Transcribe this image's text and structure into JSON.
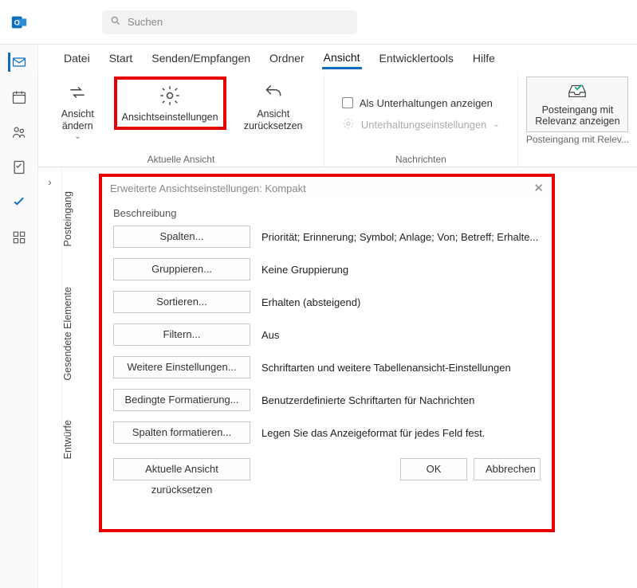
{
  "app": {
    "search_placeholder": "Suchen"
  },
  "menu": {
    "file": "Datei",
    "start": "Start",
    "sendrecv": "Senden/Empfangen",
    "folder": "Ordner",
    "view": "Ansicht",
    "devtools": "Entwicklertools",
    "help": "Hilfe"
  },
  "ribbon": {
    "group1_label": "Aktuelle Ansicht",
    "btn_change_view": "Ansicht ändern",
    "btn_view_settings": "Ansichtseinstellungen",
    "btn_reset_view": "Ansicht zurücksetzen",
    "group2_label": "Nachrichten",
    "chk_conversations": "Als Unterhaltungen anzeigen",
    "dd_conv_settings": "Unterhaltungseinstellungen",
    "group3_label": "Posteingang mit Relev...",
    "btn_focused_inbox": "Posteingang mit Relevanz anzeigen"
  },
  "vtabs": {
    "inbox": "Posteingang",
    "sent": "Gesendete Elemente",
    "drafts": "Entwürfe"
  },
  "dialog": {
    "title": "Erweiterte Ansichtseinstellungen: Kompakt",
    "section": "Beschreibung",
    "rows": [
      {
        "btn": "Spalten...",
        "desc": "Priorität; Erinnerung; Symbol; Anlage; Von; Betreff; Erhalte..."
      },
      {
        "btn": "Gruppieren...",
        "desc": "Keine Gruppierung"
      },
      {
        "btn": "Sortieren...",
        "desc": "Erhalten (absteigend)"
      },
      {
        "btn": "Filtern...",
        "desc": "Aus"
      },
      {
        "btn": "Weitere Einstellungen...",
        "desc": "Schriftarten und weitere Tabellenansicht-Einstellungen"
      },
      {
        "btn": "Bedingte Formatierung...",
        "desc": "Benutzerdefinierte Schriftarten für Nachrichten"
      },
      {
        "btn": "Spalten formatieren...",
        "desc": "Legen Sie das Anzeigeformat für jedes Feld fest."
      }
    ],
    "reset": "Aktuelle Ansicht zurücksetzen",
    "ok": "OK",
    "cancel": "Abbrechen"
  }
}
